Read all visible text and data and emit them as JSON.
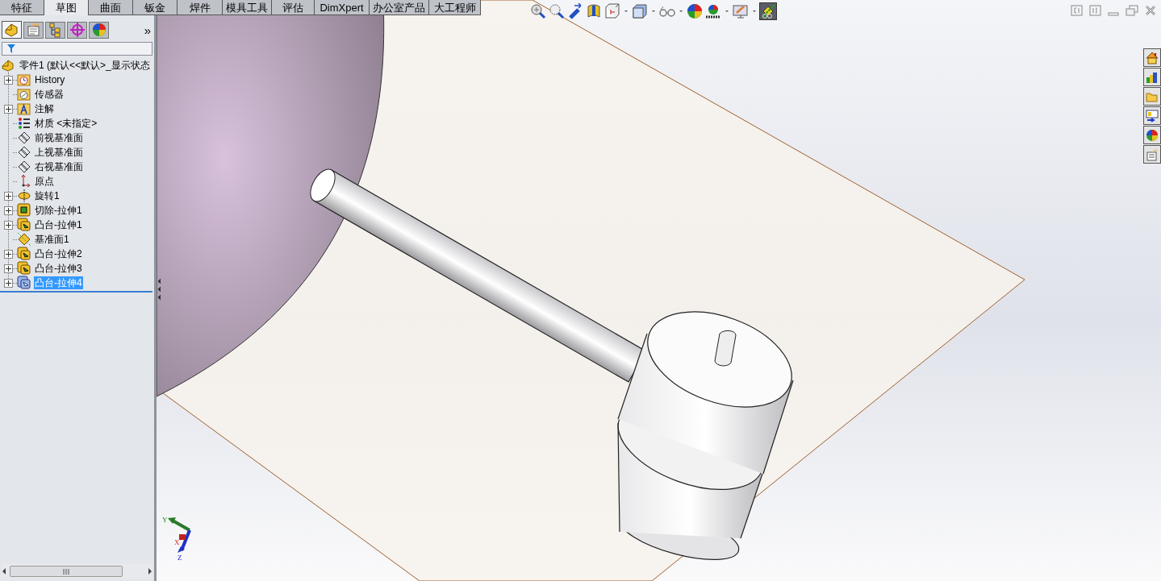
{
  "command_tabs": [
    {
      "label": "特征",
      "selected": false
    },
    {
      "label": "草图",
      "selected": true
    },
    {
      "label": "曲面",
      "selected": false
    },
    {
      "label": "钣金",
      "selected": false
    },
    {
      "label": "焊件",
      "selected": false
    },
    {
      "label": "模具工具",
      "selected": false
    },
    {
      "label": "评估",
      "selected": false
    },
    {
      "label": "DimXpert",
      "selected": false
    },
    {
      "label": "办公室产品",
      "selected": false
    },
    {
      "label": "大工程师",
      "selected": false
    }
  ],
  "panel_tabs": [
    {
      "kind": "feature",
      "selected": true
    },
    {
      "kind": "property",
      "selected": false
    },
    {
      "kind": "config",
      "selected": false
    },
    {
      "kind": "dimxpert",
      "selected": false
    },
    {
      "kind": "display",
      "selected": false
    }
  ],
  "panel_more": "»",
  "feature_tree": {
    "root": "零件1  (默认<<默认>_显示状态",
    "items": [
      {
        "label": "History",
        "kind": "history",
        "expandable": true,
        "selected": false
      },
      {
        "label": "传感器",
        "kind": "sensor",
        "expandable": false,
        "selected": false
      },
      {
        "label": "注解",
        "kind": "annotation",
        "expandable": true,
        "selected": false
      },
      {
        "label": "材质 <未指定>",
        "kind": "material",
        "expandable": false,
        "selected": false
      },
      {
        "label": "前视基准面",
        "kind": "plane",
        "expandable": false,
        "selected": false
      },
      {
        "label": "上视基准面",
        "kind": "plane",
        "expandable": false,
        "selected": false
      },
      {
        "label": "右视基准面",
        "kind": "plane",
        "expandable": false,
        "selected": false
      },
      {
        "label": "原点",
        "kind": "origin",
        "expandable": false,
        "selected": false
      },
      {
        "label": "旋转1",
        "kind": "revolve",
        "expandable": true,
        "selected": false
      },
      {
        "label": "切除-拉伸1",
        "kind": "cut",
        "expandable": true,
        "selected": false
      },
      {
        "label": "凸台-拉伸1",
        "kind": "boss",
        "expandable": true,
        "selected": false
      },
      {
        "label": "基准面1",
        "kind": "refplane",
        "expandable": false,
        "selected": false
      },
      {
        "label": "凸台-拉伸2",
        "kind": "boss",
        "expandable": true,
        "selected": false
      },
      {
        "label": "凸台-拉伸3",
        "kind": "boss",
        "expandable": true,
        "selected": false
      },
      {
        "label": "凸台-拉伸4",
        "kind": "boss",
        "expandable": true,
        "selected": true
      }
    ]
  },
  "view_toolbar": [
    {
      "kind": "zoom-fit",
      "dropdown": false,
      "selected": false
    },
    {
      "kind": "zoom-area",
      "dropdown": false,
      "selected": false
    },
    {
      "kind": "previous",
      "dropdown": false,
      "selected": false
    },
    {
      "kind": "section",
      "dropdown": false,
      "selected": false
    },
    {
      "kind": "orientation",
      "dropdown": true,
      "selected": false
    },
    {
      "kind": "display-style",
      "dropdown": true,
      "selected": false
    },
    {
      "kind": "hide-show",
      "dropdown": true,
      "selected": false
    },
    {
      "kind": "appearance",
      "dropdown": false,
      "selected": false
    },
    {
      "kind": "scene",
      "dropdown": true,
      "selected": false
    },
    {
      "kind": "view-settings",
      "dropdown": true,
      "selected": false
    },
    {
      "kind": "realview",
      "dropdown": false,
      "selected": true
    }
  ],
  "triad": {
    "y": "Y",
    "x": "X",
    "z": "Z"
  }
}
